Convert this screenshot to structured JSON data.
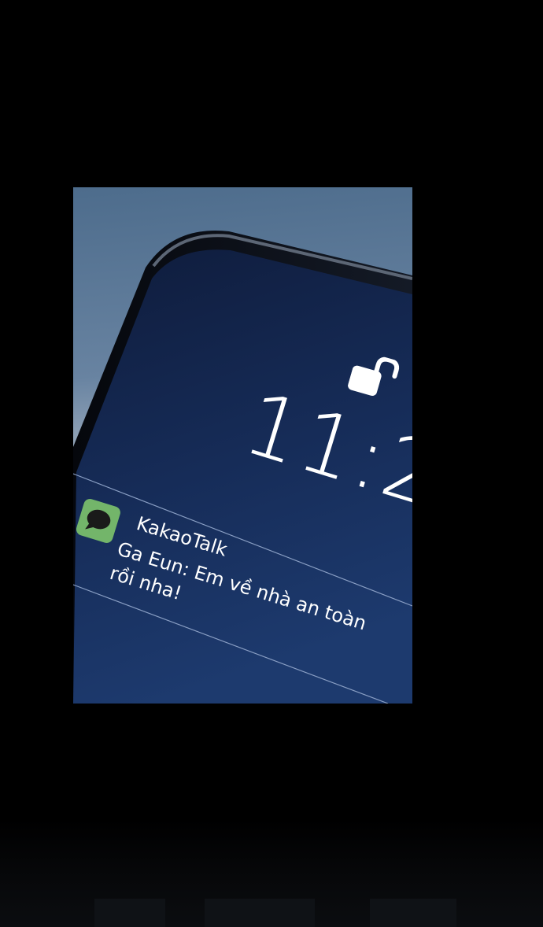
{
  "lockscreen": {
    "time_partial": "11:2",
    "lock_state": "unlocked",
    "lock_icon": "unlocked-padlock-icon"
  },
  "notification": {
    "app_icon": "chat-bubble-icon",
    "app_name": "KakaoTalk",
    "message": "Ga Eun: Em về nhà an toàn rồi nha!"
  },
  "colors": {
    "page_background": "#000000",
    "sky_top": "#4d6c8c",
    "sky_bottom": "#d9dde2",
    "screen_top": "#0f1c3c",
    "screen_bottom": "#1d3a6e",
    "app_icon_green": "#73b56a",
    "text": "#ffffff"
  }
}
